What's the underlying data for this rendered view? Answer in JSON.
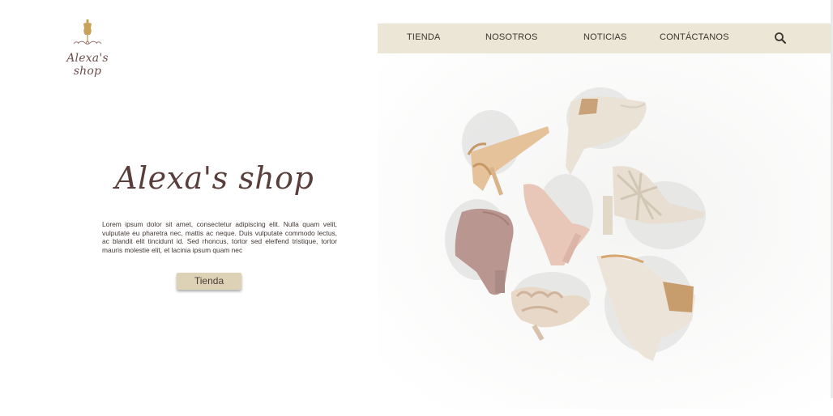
{
  "brand": {
    "logo_text": "Alexa's shop",
    "logo_icon": "dress-form-icon",
    "accent_color": "#c9a25a"
  },
  "nav": {
    "background": "#ece6d6",
    "items": [
      {
        "label": "TIENDA"
      },
      {
        "label": "NOSOTROS"
      },
      {
        "label": "NOTICIAS"
      },
      {
        "label": "CONTÁCTANOS"
      }
    ],
    "search_icon": "search-icon"
  },
  "hero": {
    "title": "Alexa's shop",
    "body": "Lorem ipsum dolor sit amet, consectetur adipiscing elit. Nulla quam velit, vulputate eu pharetra nec, mattis ac neque. Duis vulputate commodo lectus, ac blandit elit tincidunt id. Sed rhoncus, tortor sed eleifend tristique, tortor mauris molestie elit, et lacinia ipsum quam nec",
    "button_label": "Tienda",
    "button_color": "#ddd2b6"
  },
  "image": {
    "subject": "shoes-flatlay-image"
  }
}
